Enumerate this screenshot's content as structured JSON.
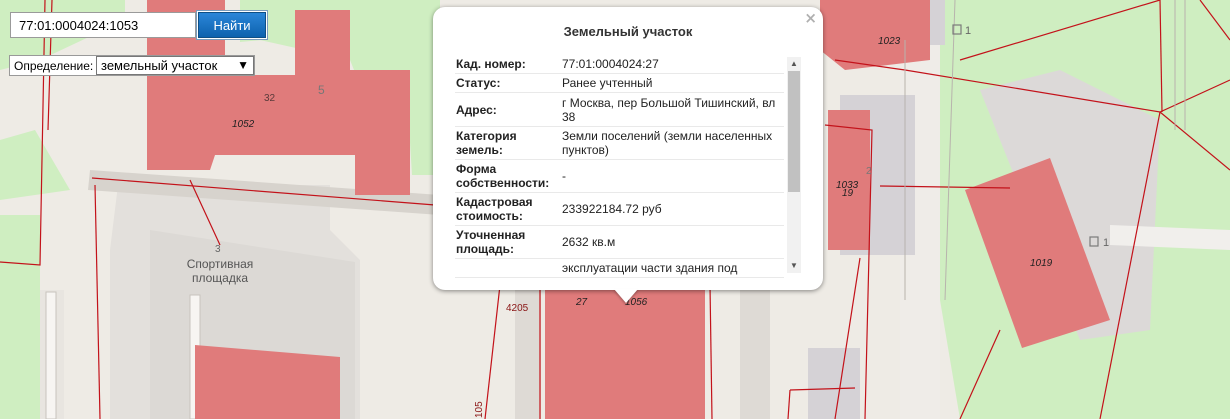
{
  "search": {
    "value": "77:01:0004024:1053",
    "button_label": "Найти"
  },
  "definition": {
    "label": "Определение:",
    "selected": "земельный участок"
  },
  "popup": {
    "close_symbol": "×",
    "title": "Земельный участок",
    "rows": [
      {
        "key": "Кад. номер:",
        "value": "77:01:0004024:27"
      },
      {
        "key": "Статус:",
        "value": "Ранее учтенный"
      },
      {
        "key": "Адрес:",
        "value": "г Москва, пер Большой Тишинский, вл 38"
      },
      {
        "key": "Категория земель:",
        "value": "Земли поселений (земли населенных пунктов)"
      },
      {
        "key": "Форма собственности:",
        "value": "-"
      },
      {
        "key": "Кадастровая стоимость:",
        "value": "233922184.72 руб"
      },
      {
        "key": "Уточненная площадь:",
        "value": "2632 кв.м"
      },
      {
        "key": "",
        "value": "эксплуатации части здания под"
      }
    ]
  },
  "map": {
    "labels": {
      "b1052": "1052",
      "b32": "32",
      "b5": "5",
      "b1023": "1023",
      "b1033": "1033",
      "b19": "19",
      "b1019": "1019",
      "b27": "27",
      "b1056": "1056",
      "b4205": "4205",
      "b105": "105",
      "b3": "3",
      "b1a": "1",
      "b1b": "1",
      "b2": "2",
      "sport_line1": "Спортивная",
      "sport_line2": "площадка"
    },
    "colors": {
      "background": "#eeebe5",
      "green": "#cfeec1",
      "building": "#e07b7b",
      "building_gray": "#d5d2d6",
      "parcel_line": "#c3121a"
    }
  }
}
